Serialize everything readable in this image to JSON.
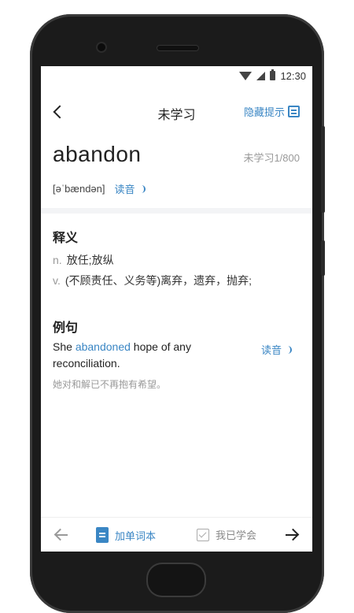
{
  "status_bar": {
    "time": "12:30"
  },
  "nav": {
    "title": "未学习",
    "hide_hint_label": "隐藏提示"
  },
  "word": {
    "text": "abandon",
    "progress": "未学习1/800",
    "phonetic": "[əˈbændən]",
    "read_label": "读音"
  },
  "definition": {
    "title": "释义",
    "items": [
      {
        "pos": "n.",
        "meaning": "放任;放纵"
      },
      {
        "pos": "v.",
        "meaning": "(不顾责任、义务等)离弃，遗弃，抛弃;"
      }
    ]
  },
  "example": {
    "title": "例句",
    "sentence_before": "She ",
    "sentence_highlight": "abandoned",
    "sentence_after": " hope of any reconciliation.",
    "read_label": "读音",
    "translation": "她对和解已不再抱有希望。"
  },
  "bottom_bar": {
    "add_label": "加单词本",
    "learned_label": "我已学会"
  },
  "colors": {
    "accent": "#3a86c4",
    "muted": "#999999"
  }
}
